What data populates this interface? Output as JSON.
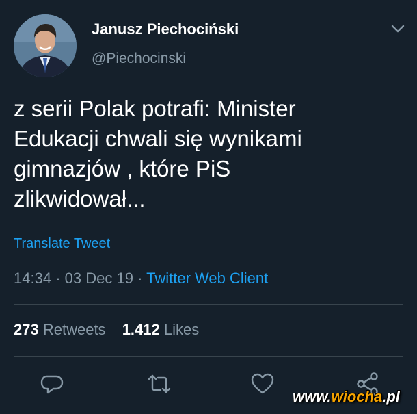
{
  "author": {
    "display_name": "Janusz Piechociński",
    "handle": "@Piechocinski"
  },
  "tweet": {
    "text": "z serii Polak potrafi: Minister\nEdukacji chwali się wynikami\ngimnazjów , które PiS\nzlikwidował...",
    "translate_label": "Translate Tweet",
    "time": "14:34",
    "separator": "·",
    "date": "03 Dec 19",
    "source": "Twitter Web Client"
  },
  "stats": {
    "retweets_count": "273",
    "retweets_label": "Retweets",
    "likes_count": "1.412",
    "likes_label": "Likes"
  },
  "actions": {
    "icons": [
      "reply-icon",
      "retweet-icon",
      "like-icon",
      "share-icon"
    ]
  },
  "watermark": {
    "prefix": "www.",
    "brand": "wiocha",
    "suffix": ".pl"
  },
  "colors": {
    "background": "#15202b",
    "accent": "#1da1f2",
    "secondary_text": "#8899a6",
    "divider": "#38444d"
  }
}
